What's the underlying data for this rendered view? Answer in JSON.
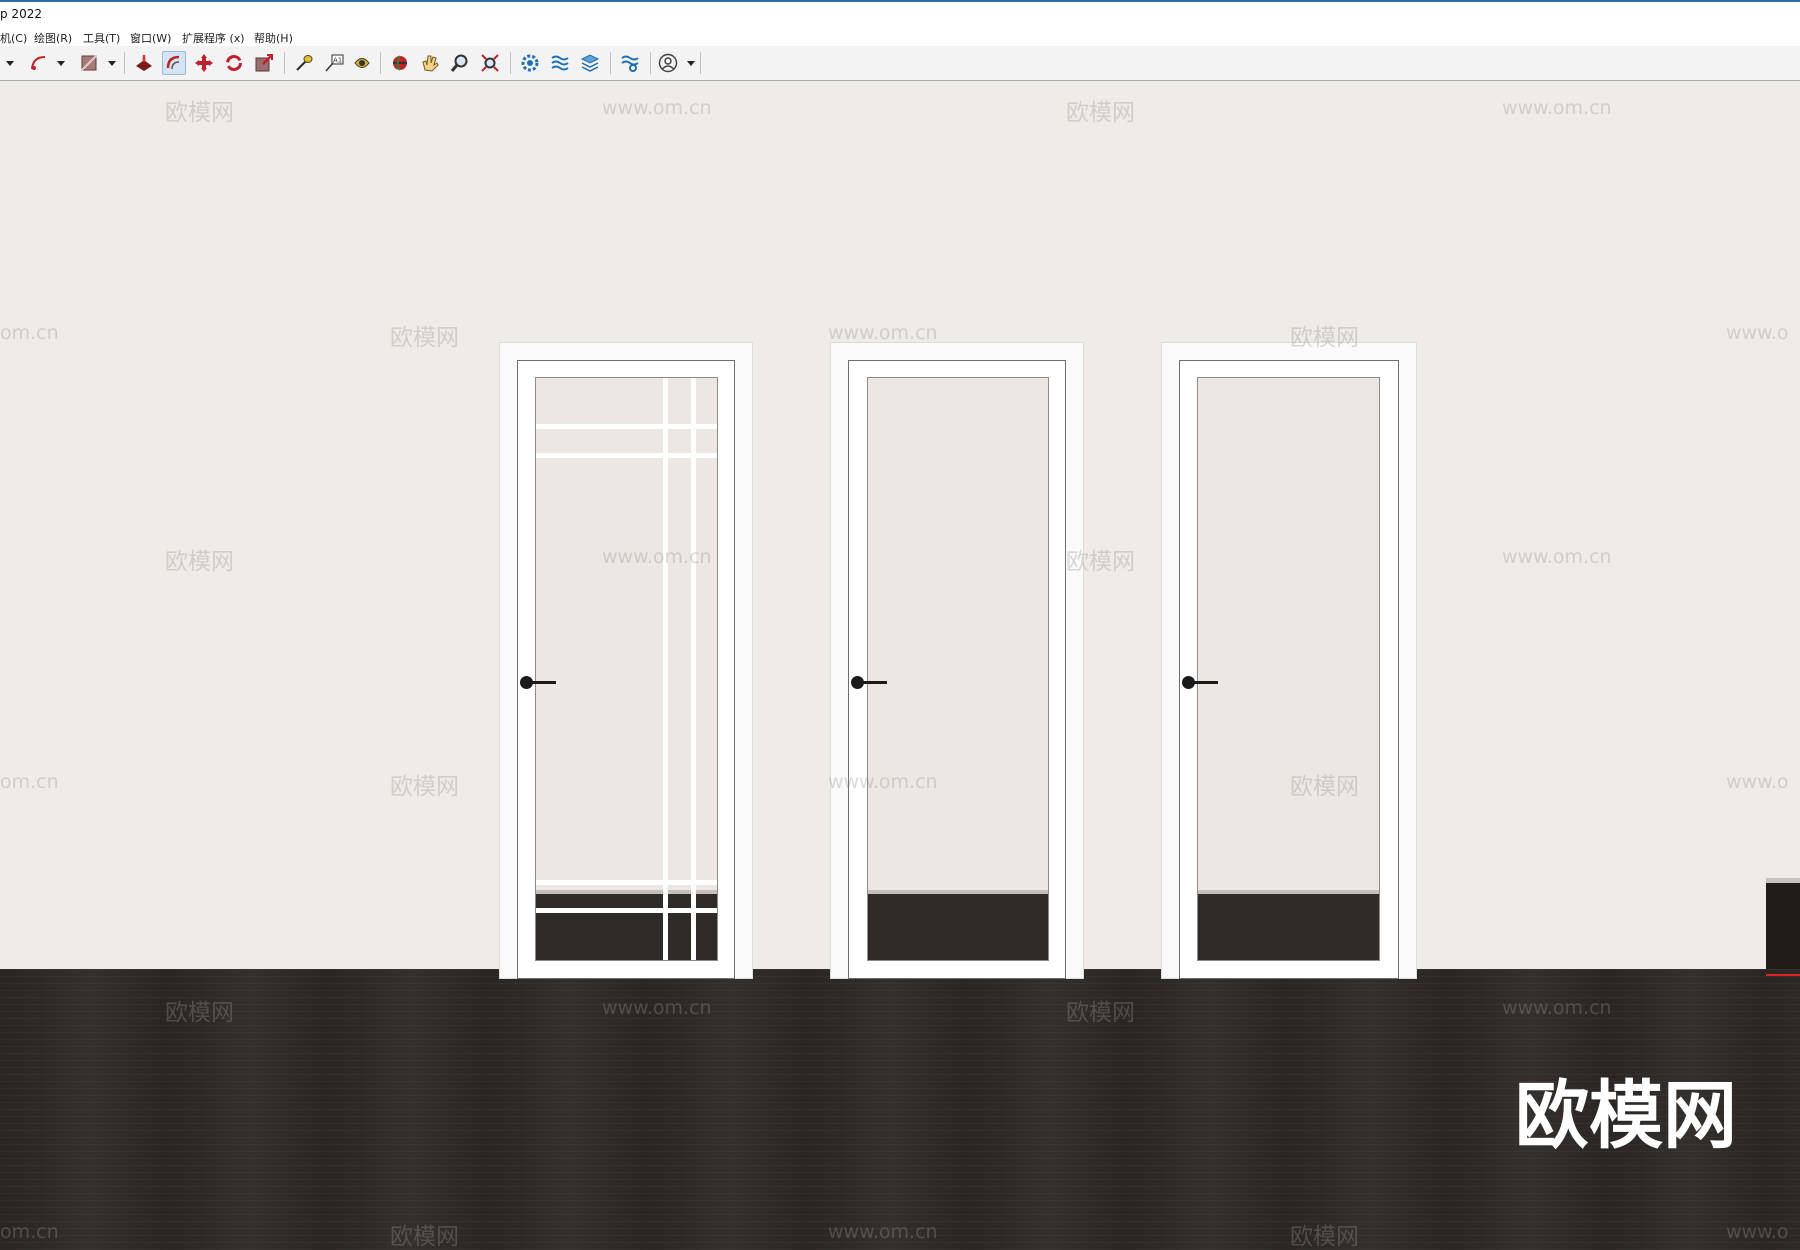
{
  "window": {
    "title": "p 2022",
    "accent_color": "#2e6fa3"
  },
  "menu": {
    "items": [
      "机(C)",
      "绘图(R)",
      "工具(T)",
      "窗口(W)",
      "扩展程序 (x)",
      "帮助(H)"
    ]
  },
  "toolbar": {
    "buttons": [
      "dropdown-icon",
      "arc-pencil-icon",
      "paint-bucket-icon",
      "push-pull-icon",
      "offset-icon",
      "move-icon",
      "rotate-icon",
      "scale-icon",
      "tape-measure-icon",
      "text-label-icon",
      "paint-icon",
      "orbit-icon",
      "pan-icon",
      "zoom-icon",
      "zoom-extents-icon",
      "extension-gear-icon",
      "extension-wave-icon",
      "extension-layers-icon",
      "extension-settings-icon",
      "user-account-icon"
    ],
    "active_button": "offset-icon",
    "account_label": "user-account"
  },
  "scene": {
    "wall_color": "#efebe7",
    "floor_color": "#2d2926",
    "doors": [
      {
        "name": "door-grid-glass",
        "style": "glass with grid bars"
      },
      {
        "name": "door-plain-glass",
        "style": "full glass"
      },
      {
        "name": "door-slim-glass",
        "style": "full glass slim frame"
      }
    ]
  },
  "watermarks": {
    "brand_text": "欧模网",
    "url_text": "www.om.cn",
    "url_fragment_left": "om.cn",
    "url_fragment_right": "www.o",
    "big_brand": "欧模网"
  }
}
